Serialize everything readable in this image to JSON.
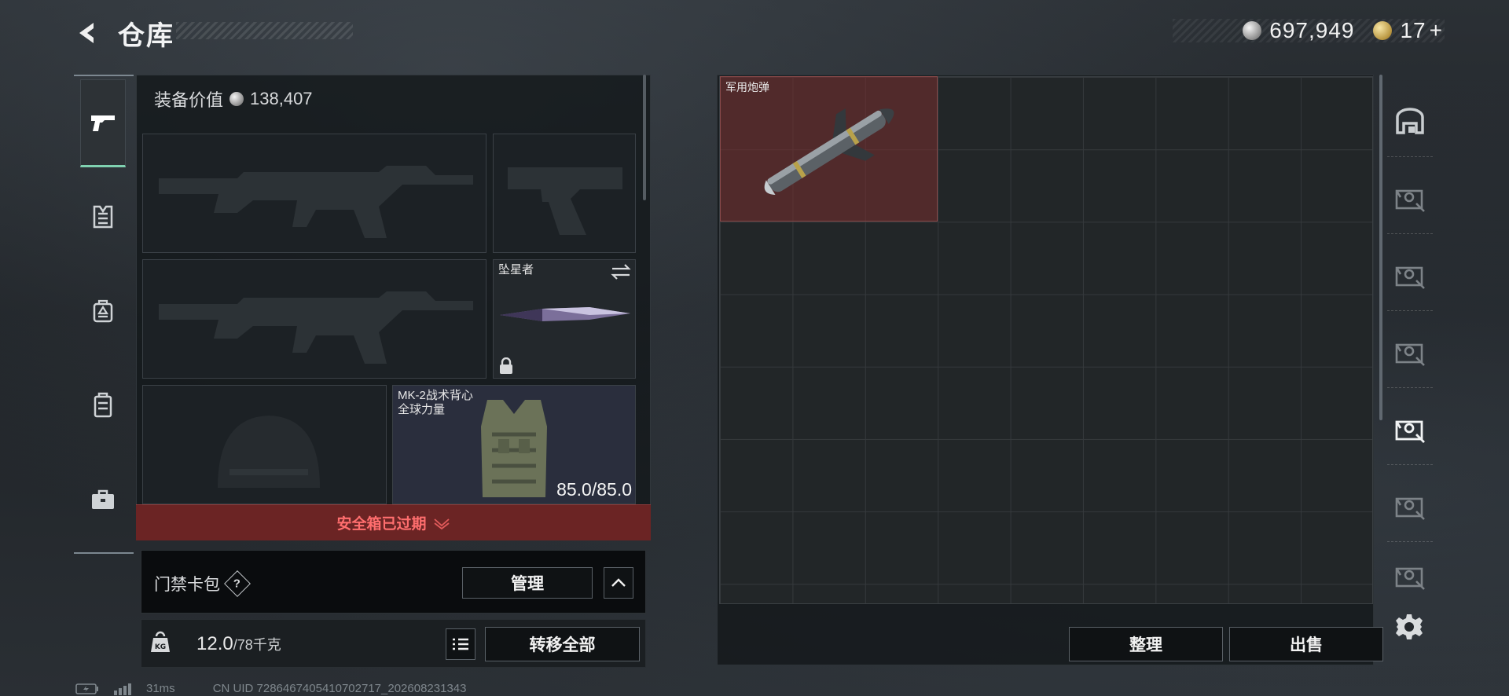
{
  "header": {
    "title": "仓库",
    "silver_amount": "697,949",
    "gold_amount": "17",
    "gold_plus": "+"
  },
  "loadout": {
    "equipment_value_label": "装备价值",
    "equipment_value": "138,407",
    "melee_name": "坠星者",
    "vest_name": "MK-2战术背心",
    "vest_brand": "全球力量",
    "vest_durability": "85.0/85.0",
    "safe_box_status": "安全箱已过期"
  },
  "access_card": {
    "label": "门禁卡包",
    "help": "?",
    "manage_label": "管理"
  },
  "weight": {
    "current": "12.0",
    "max": "/78千克",
    "transfer_all_label": "转移全部"
  },
  "storage": {
    "item_label": "军用炮弹",
    "sort_label": "整理",
    "sell_label": "出售"
  },
  "status": {
    "ping": "31ms",
    "uid": "CN UID 7286467405410702717_202608231343"
  },
  "colors": {
    "accent_green": "#7fd1b0",
    "alert_red": "#ff6e6e",
    "alert_bg": "#6b2424"
  },
  "icons": [
    "back-arrow-icon",
    "silver-coin-icon",
    "gold-coin-icon",
    "pistol-tab-icon",
    "armor-tab-icon",
    "backpack-tab-icon",
    "chest-rig-tab-icon",
    "briefcase-tab-icon",
    "lock-icon",
    "swap-icon",
    "chevron-down-icon",
    "help-icon",
    "chevron-up-icon",
    "weight-icon",
    "list-icon",
    "home-storage-icon",
    "storage-page-icon",
    "settings-gear-icon",
    "battery-icon",
    "signal-icon"
  ]
}
